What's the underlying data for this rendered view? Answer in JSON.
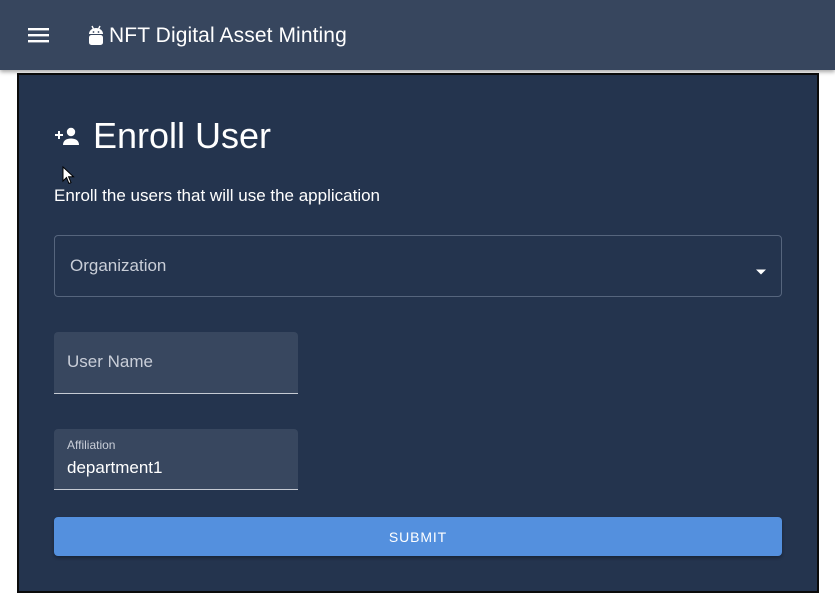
{
  "appbar": {
    "title": "NFT Digital Asset Minting",
    "menu_icon": "hamburger-menu-icon",
    "brand_icon": "android-icon",
    "background": "#37465e"
  },
  "page": {
    "heading": "Enroll User",
    "heading_icon": "person-add-icon",
    "subtitle": "Enroll the users that will use the application",
    "background": "#24344e"
  },
  "form": {
    "organization": {
      "label": "Organization",
      "selected_value": "",
      "arrow_icon": "dropdown-arrow-icon"
    },
    "username": {
      "label": "User Name",
      "value": ""
    },
    "affiliation": {
      "label": "Affiliation",
      "value": "department1"
    },
    "submit_label": "SUBMIT",
    "submit_color": "#5490de"
  }
}
